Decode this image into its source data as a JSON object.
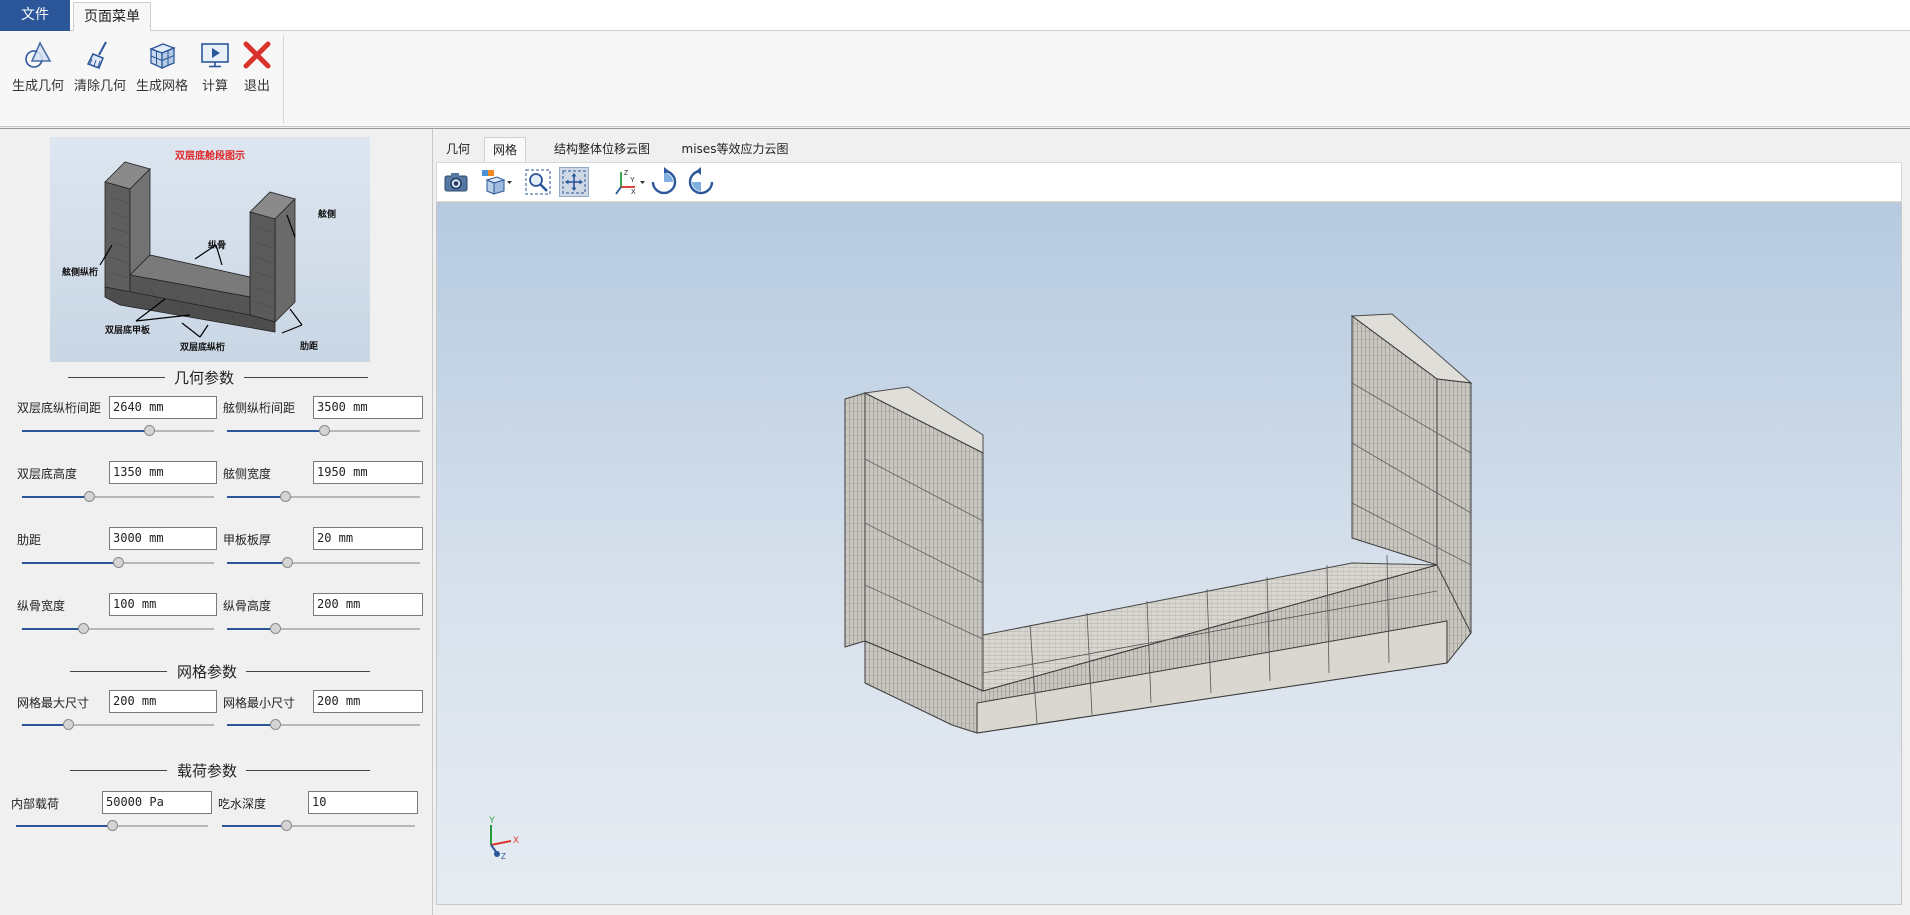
{
  "ribbon": {
    "tabs": [
      {
        "label": "文件"
      },
      {
        "label": "页面菜单"
      }
    ],
    "buttons": [
      {
        "label": "生成几何",
        "icon": "geometry-icon"
      },
      {
        "label": "清除几何",
        "icon": "broom-icon"
      },
      {
        "label": "生成网格",
        "icon": "mesh-cube-icon"
      },
      {
        "label": "计算",
        "icon": "monitor-play-icon"
      },
      {
        "label": "退出",
        "icon": "close-icon"
      }
    ]
  },
  "preview": {
    "title": "双层底舱段图示",
    "labels": [
      "舷侧",
      "纵骨",
      "舷侧纵桁",
      "双层底甲板",
      "双层底纵桁",
      "肋距"
    ]
  },
  "geometry_section": {
    "title": "几何参数",
    "params": [
      {
        "label": "双层底纵桁间距",
        "value": "2640 mm",
        "level": 0.66
      },
      {
        "label": "舷侧纵桁间距",
        "value": "3500 mm",
        "level": 0.5
      },
      {
        "label": "双层底高度",
        "value": "1350 mm",
        "level": 0.35
      },
      {
        "label": "舷侧宽度",
        "value": "1950 mm",
        "level": 0.3
      },
      {
        "label": "肋距",
        "value": "3000 mm",
        "level": 0.5
      },
      {
        "label": "甲板板厚",
        "value": "20 mm",
        "level": 0.31
      },
      {
        "label": "纵骨宽度",
        "value": "100 mm",
        "level": 0.32
      },
      {
        "label": "纵骨高度",
        "value": "200 mm",
        "level": 0.25
      }
    ]
  },
  "mesh_section": {
    "title": "网格参数",
    "params": [
      {
        "label": "网格最大尺寸",
        "value": "200 mm",
        "level": 0.24
      },
      {
        "label": "网格最小尺寸",
        "value": "200 mm",
        "level": 0.25
      }
    ]
  },
  "load_section": {
    "title": "载荷参数",
    "params": [
      {
        "label": "内部载荷",
        "value": "50000 Pa",
        "level": 0.5
      },
      {
        "label": "吃水深度",
        "value": "10",
        "level": 0.33
      }
    ]
  },
  "viewer": {
    "tabs": [
      {
        "label": "几何"
      },
      {
        "label": "网格"
      },
      {
        "label": "结构整体位移云图"
      },
      {
        "label": "mises等效应力云图"
      }
    ],
    "active_tab": "网格",
    "toolbar": [
      {
        "icon": "camera-icon"
      },
      {
        "icon": "view-cube-dropdown-icon"
      },
      {
        "icon": "zoom-window-icon"
      },
      {
        "icon": "pan-icon"
      },
      {
        "icon": "axes-dropdown-icon"
      },
      {
        "icon": "rotate-cw-icon"
      },
      {
        "icon": "rotate-ccw-icon"
      }
    ],
    "triad": {
      "x": "X",
      "y": "Y",
      "z": "Z"
    }
  },
  "colors": {
    "accent": "#2b579a",
    "viewport_top": "#b6cae0",
    "viewport_bottom": "#e7ecf2",
    "mesh_face": "#cfcdc6",
    "mesh_line": "#4a4a4a"
  }
}
